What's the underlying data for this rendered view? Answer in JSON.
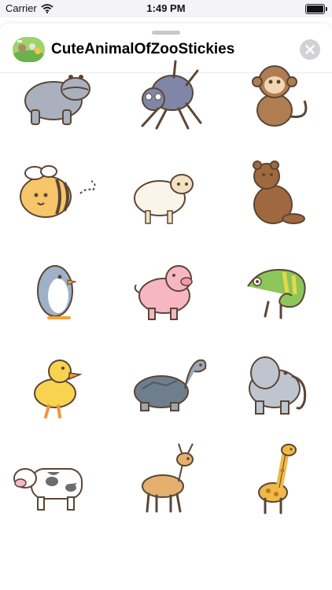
{
  "status_bar": {
    "carrier": "Carrier",
    "time": "1:49 PM",
    "battery_level": 1.0
  },
  "header": {
    "title": "CuteAnimalOfZooStickies",
    "app_icon": "zoo-animals-icon",
    "close_icon": "close-icon"
  },
  "stickers": [
    {
      "animal": "hippo"
    },
    {
      "animal": "spider"
    },
    {
      "animal": "monkey"
    },
    {
      "animal": "bee"
    },
    {
      "animal": "sheep"
    },
    {
      "animal": "bear"
    },
    {
      "animal": "penguin"
    },
    {
      "animal": "pig"
    },
    {
      "animal": "chameleon"
    },
    {
      "animal": "duck"
    },
    {
      "animal": "turtle"
    },
    {
      "animal": "elephant"
    },
    {
      "animal": "cow"
    },
    {
      "animal": "deer"
    },
    {
      "animal": "giraffe"
    }
  ],
  "colors": {
    "hippo": "#aab0bd",
    "spider": "#7f86a8",
    "monkey": "#b07d52",
    "bee": "#f7c56a",
    "sheep": "#faf5e8",
    "bear": "#a0683e",
    "penguin": "#9fb1c6",
    "pig": "#f6b7c3",
    "chameleon": "#8cc55a",
    "duck": "#f8d34f",
    "turtle": "#6f7e8d",
    "elephant": "#bfc5cf",
    "cow": "#ffffff",
    "deer": "#e3b06e",
    "giraffe": "#f0b948",
    "outline": "#5b4636"
  }
}
